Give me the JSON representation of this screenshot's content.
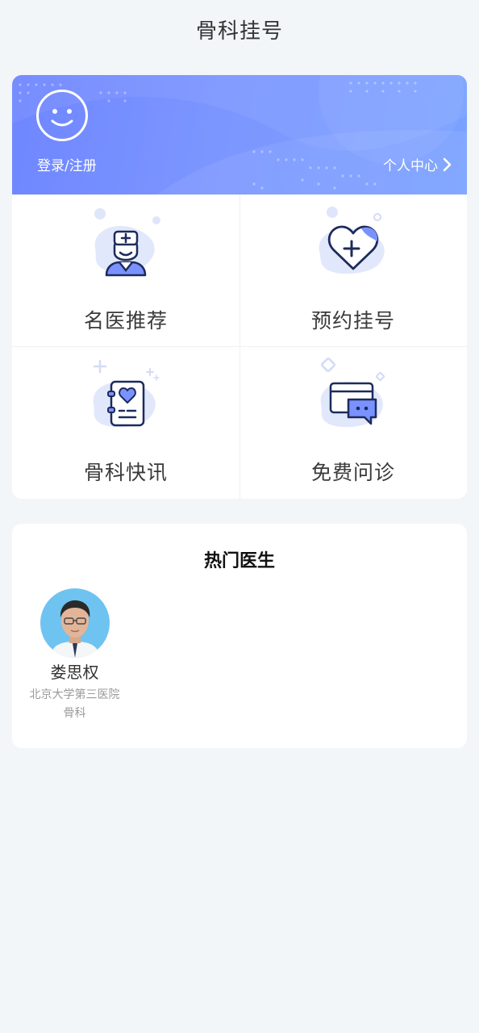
{
  "header": {
    "title": "骨科挂号"
  },
  "banner": {
    "login_label": "登录/注册",
    "profile_label": "个人中心",
    "avatar_icon": "smiley-face-icon",
    "chevron_icon": "chevron-right-icon",
    "gradient": [
      "#6f86ff",
      "#7aa2ff"
    ]
  },
  "menu": {
    "items": [
      {
        "label": "名医推荐",
        "icon": "doctor-icon"
      },
      {
        "label": "预约挂号",
        "icon": "heart-plus-icon"
      },
      {
        "label": "骨科快讯",
        "icon": "news-book-icon"
      },
      {
        "label": "免费问诊",
        "icon": "chat-card-icon"
      }
    ]
  },
  "hot_doctors": {
    "title": "热门医生",
    "doctors": [
      {
        "name": "娄思权",
        "hospital": "北京大学第三医院",
        "department": "骨科",
        "photo": "doctor-portrait"
      }
    ]
  },
  "colors": {
    "accent": "#7490ff",
    "icon_stroke": "#1d2b5c",
    "page_bg": "#f2f6f9"
  }
}
